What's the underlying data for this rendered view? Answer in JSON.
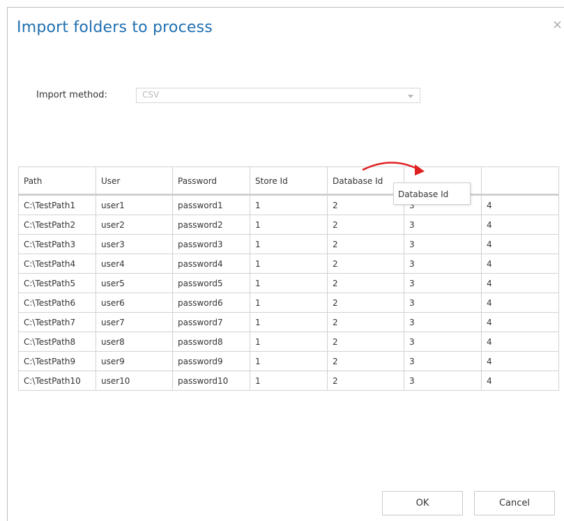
{
  "dialog": {
    "title": "Import folders to process",
    "close_glyph": "×"
  },
  "import_method": {
    "label": "Import method:",
    "value": "CSV"
  },
  "table": {
    "columns": [
      "Path",
      "User",
      "Password",
      "Store Id",
      "Database Id",
      "",
      ""
    ],
    "rows": [
      [
        "C:\\TestPath1",
        "user1",
        "password1",
        "1",
        "2",
        "3",
        "4"
      ],
      [
        "C:\\TestPath2",
        "user2",
        "password2",
        "1",
        "2",
        "3",
        "4"
      ],
      [
        "C:\\TestPath3",
        "user3",
        "password3",
        "1",
        "2",
        "3",
        "4"
      ],
      [
        "C:\\TestPath4",
        "user4",
        "password4",
        "1",
        "2",
        "3",
        "4"
      ],
      [
        "C:\\TestPath5",
        "user5",
        "password5",
        "1",
        "2",
        "3",
        "4"
      ],
      [
        "C:\\TestPath6",
        "user6",
        "password6",
        "1",
        "2",
        "3",
        "4"
      ],
      [
        "C:\\TestPath7",
        "user7",
        "password7",
        "1",
        "2",
        "3",
        "4"
      ],
      [
        "C:\\TestPath8",
        "user8",
        "password8",
        "1",
        "2",
        "3",
        "4"
      ],
      [
        "C:\\TestPath9",
        "user9",
        "password9",
        "1",
        "2",
        "3",
        "4"
      ],
      [
        "C:\\TestPath10",
        "user10",
        "password10",
        "1",
        "2",
        "3",
        "4"
      ]
    ]
  },
  "drag_tooltip": "Database Id",
  "annotation_color": "#e02020",
  "buttons": {
    "ok": "OK",
    "cancel": "Cancel"
  }
}
